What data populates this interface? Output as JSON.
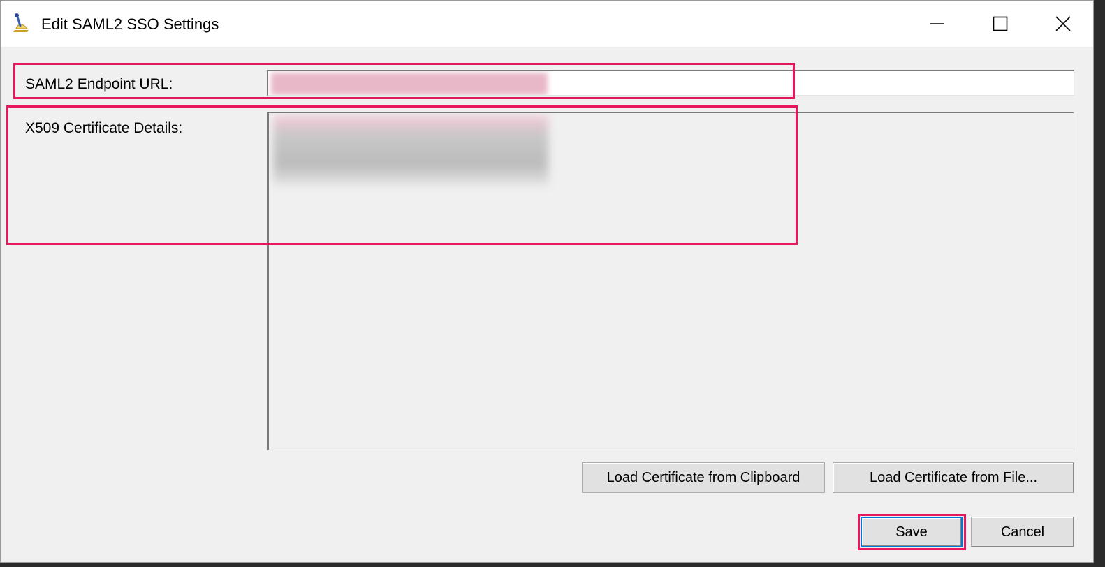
{
  "window": {
    "title": "Edit SAML2 SSO Settings",
    "icon": "pen-and-ink-icon",
    "controls": {
      "minimize": "minimize-icon",
      "maximize": "maximize-icon",
      "close": "close-icon"
    }
  },
  "form": {
    "endpoint_label": "SAML2 Endpoint URL:",
    "endpoint_value": "",
    "certificate_label": "X509 Certificate Details:",
    "certificate_value": ""
  },
  "buttons": {
    "load_clipboard": "Load Certificate from Clipboard",
    "load_file": "Load Certificate from File...",
    "save": "Save",
    "cancel": "Cancel"
  },
  "annotations": {
    "highlight_color": "#e8175d"
  },
  "colors": {
    "window_bg": "#f0f0f0",
    "titlebar_bg": "#ffffff",
    "button_bg": "#e1e1e1",
    "focus_border": "#0078d7"
  }
}
